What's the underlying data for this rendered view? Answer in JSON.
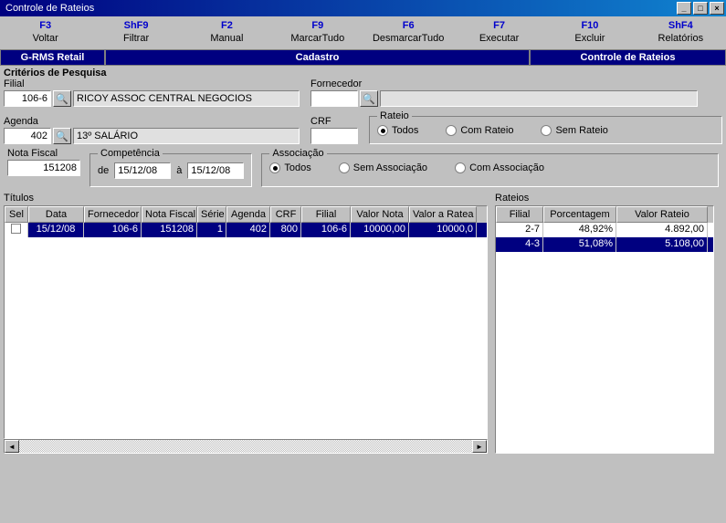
{
  "window": {
    "title": "Controle de Rateios"
  },
  "toolbar": [
    {
      "key": "F3",
      "label": "Voltar"
    },
    {
      "key": "ShF9",
      "label": "Filtrar"
    },
    {
      "key": "F2",
      "label": "Manual"
    },
    {
      "key": "F9",
      "label": "MarcarTudo"
    },
    {
      "key": "F6",
      "label": "DesmarcarTudo"
    },
    {
      "key": "F7",
      "label": "Executar"
    },
    {
      "key": "F10",
      "label": "Excluir"
    },
    {
      "key": "ShF4",
      "label": "Relatórios"
    }
  ],
  "bands": {
    "left": "G-RMS Retail",
    "center": "Cadastro",
    "right": "Controle de Rateios"
  },
  "crit": {
    "title": "Critérios de Pesquisa",
    "filial_label": "Filial",
    "filial": "106-6",
    "filial_desc": "RICOY ASSOC CENTRAL NEGOCIOS",
    "forn_label": "Fornecedor",
    "forn": "",
    "forn_desc": "",
    "agenda_label": "Agenda",
    "agenda": "402",
    "agenda_desc": "13º SALÁRIO",
    "crf_label": "CRF",
    "crf": "",
    "nf_label": "Nota Fiscal",
    "nf": "151208",
    "comp_label": "Competência",
    "de_label": "de",
    "a_label": "à",
    "comp_de": "15/12/08",
    "comp_a": "15/12/08",
    "rateio": {
      "legend": "Rateio",
      "todos": "Todos",
      "com": "Com Rateio",
      "sem": "Sem Rateio",
      "selected": "todos"
    },
    "assoc": {
      "legend": "Associação",
      "todos": "Todos",
      "sem": "Sem Associação",
      "com": "Com Associação",
      "selected": "todos"
    }
  },
  "titulos": {
    "label": "Títulos",
    "headers": [
      "Sel",
      "Data",
      "Fornecedor",
      "Nota Fiscal",
      "Série",
      "Agenda",
      "CRF",
      "Filial",
      "Valor Nota",
      "Valor a Ratea"
    ],
    "rows": [
      {
        "data": "15/12/08",
        "forn": "106-6",
        "nf": "151208",
        "serie": "1",
        "agenda": "402",
        "crf": "800",
        "filial": "106-6",
        "vn": "10000,00",
        "vr": "10000,0"
      }
    ]
  },
  "rateios": {
    "label": "Rateios",
    "headers": [
      "Filial",
      "Porcentagem",
      "Valor Rateio"
    ],
    "rows": [
      {
        "filial": "2-7",
        "pct": "48,92%",
        "valor": "4.892,00",
        "sel": false
      },
      {
        "filial": "4-3",
        "pct": "51,08%",
        "valor": "5.108,00",
        "sel": true
      }
    ]
  }
}
